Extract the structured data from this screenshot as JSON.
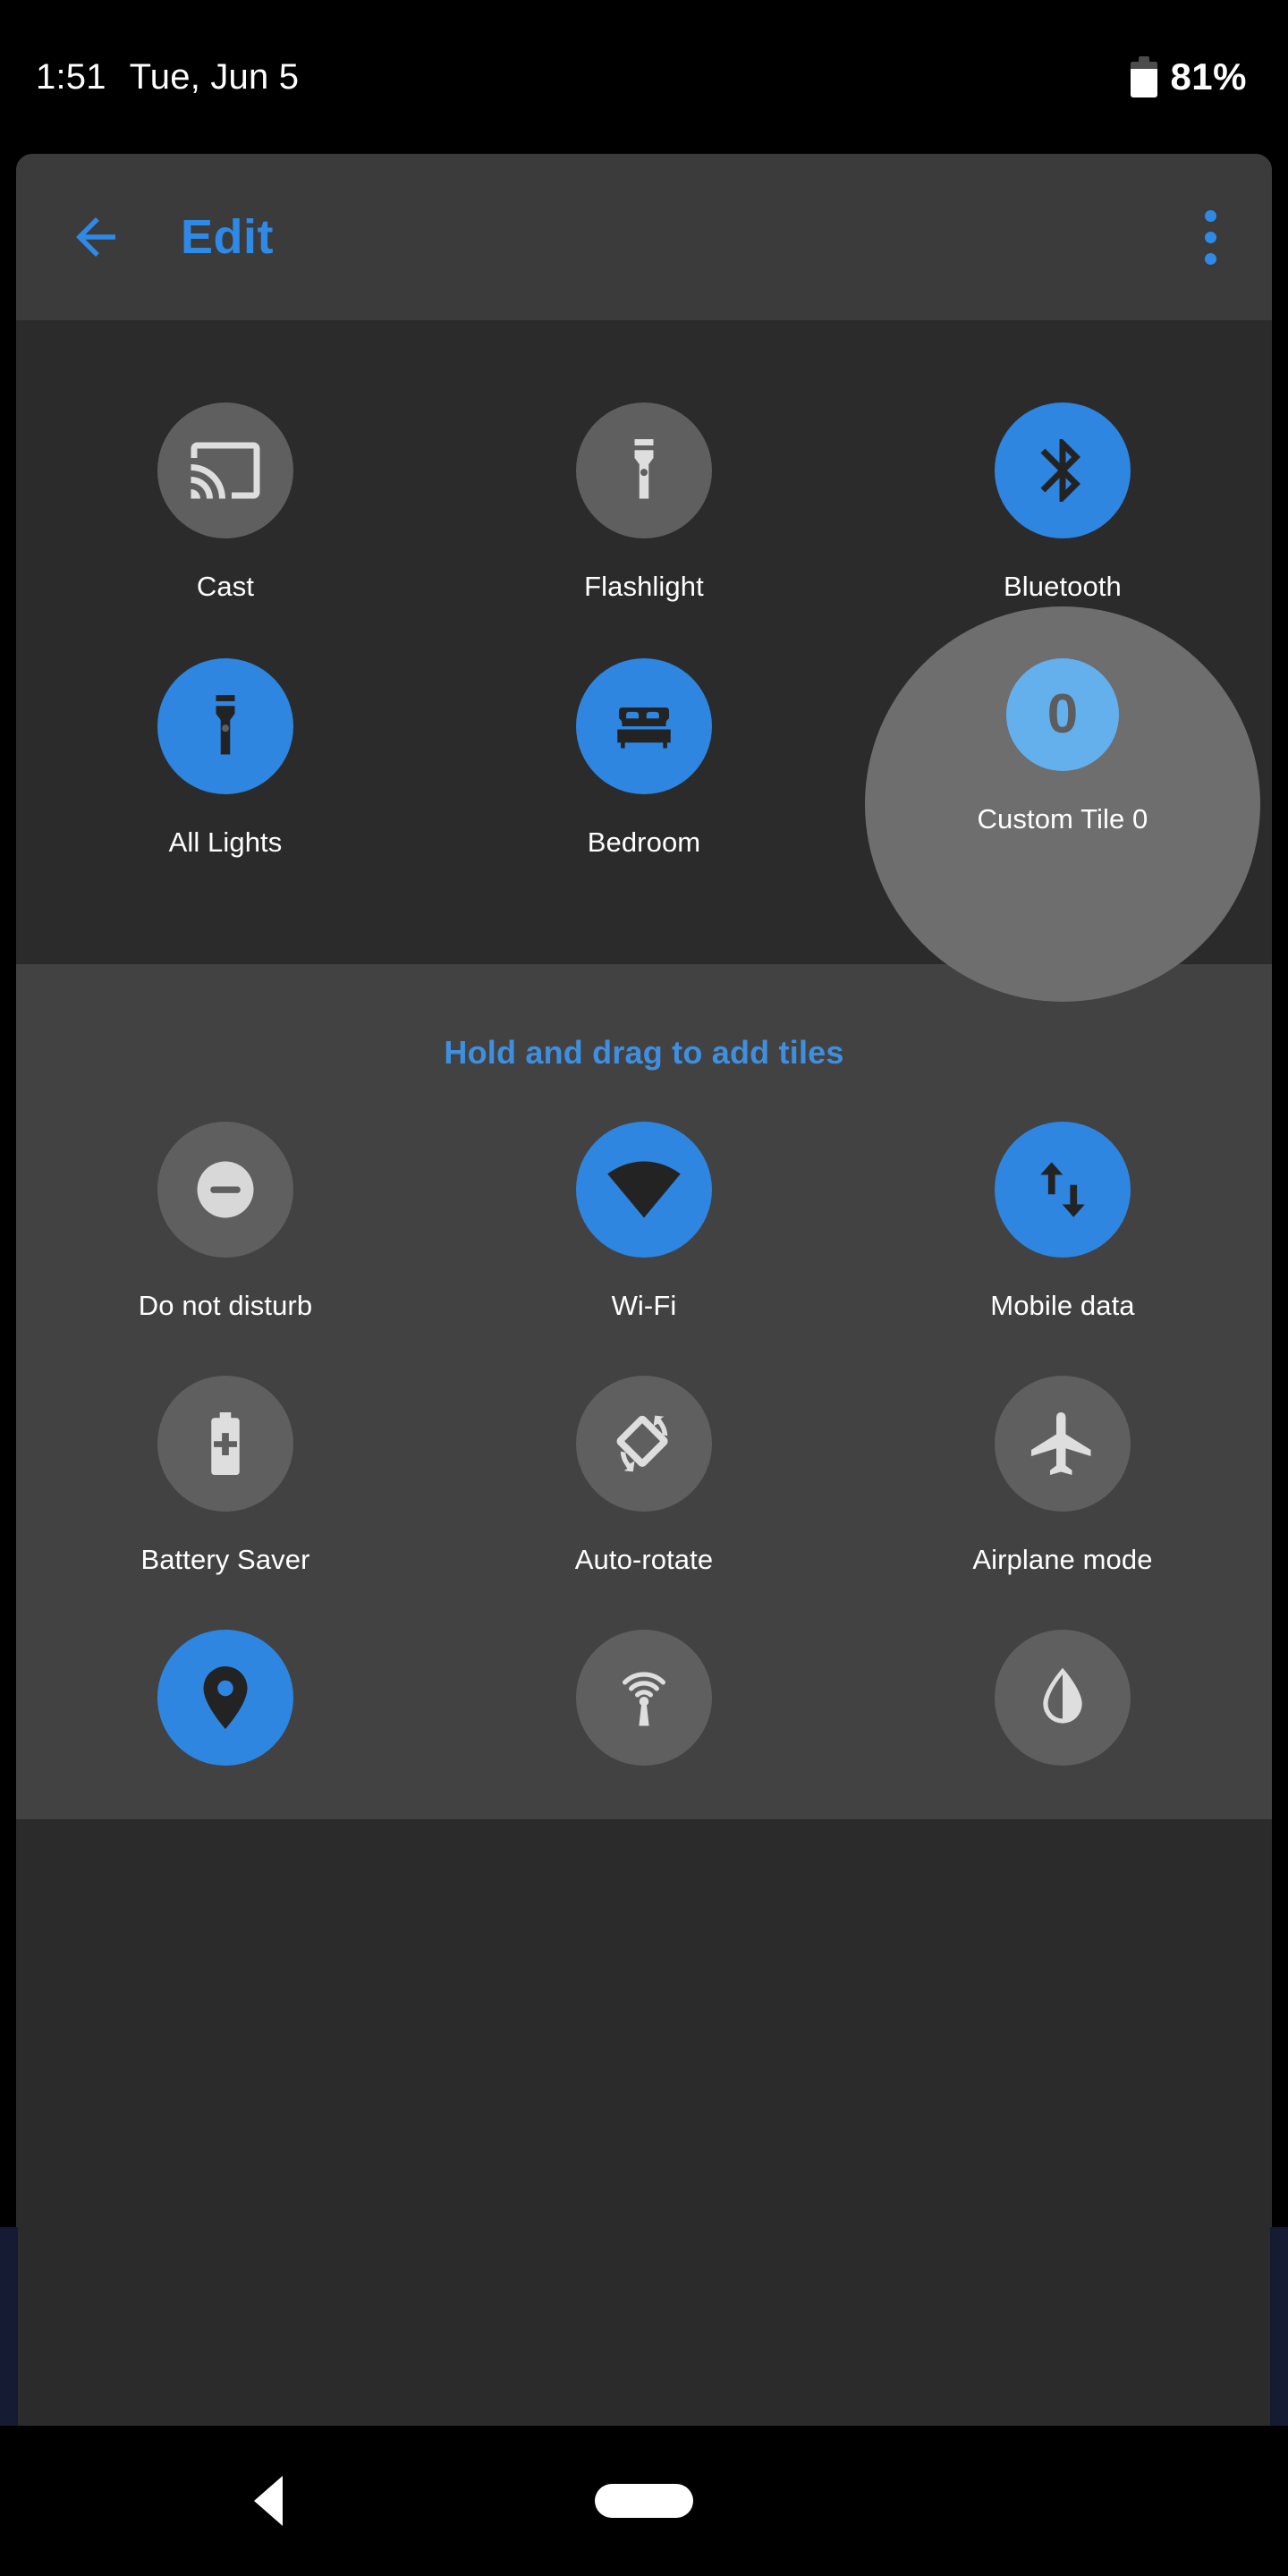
{
  "status_bar": {
    "time": "1:51",
    "date": "Tue, Jun 5",
    "battery_percent": "81%",
    "battery_icon": "battery-icon"
  },
  "toolbar": {
    "title": "Edit",
    "back_icon": "back-arrow-icon",
    "overflow_icon": "overflow-menu-icon",
    "accent_color": "#2e8ae6"
  },
  "current_tiles": {
    "rows": [
      [
        {
          "label": "Cast",
          "icon": "cast-icon",
          "state": "off"
        },
        {
          "label": "Flashlight",
          "icon": "flashlight-icon",
          "state": "off"
        },
        {
          "label": "Bluetooth",
          "icon": "bluetooth-icon",
          "state": "on"
        }
      ],
      [
        {
          "label": "All Lights",
          "icon": "flashlight-icon",
          "state": "on"
        },
        {
          "label": "Bedroom",
          "icon": "bed-icon",
          "state": "on"
        },
        {
          "label": "Custom Tile 0",
          "icon": "zero-icon",
          "icon_text": "0",
          "state": "selected"
        }
      ]
    ]
  },
  "available_section": {
    "hint": "Hold and drag to add tiles",
    "hint_color": "#3f8fe0",
    "rows": [
      [
        {
          "label": "Do not disturb",
          "icon": "do-not-disturb-icon",
          "state": "off"
        },
        {
          "label": "Wi-Fi",
          "icon": "wifi-icon",
          "state": "on"
        },
        {
          "label": "Mobile data",
          "icon": "mobile-data-icon",
          "state": "on"
        }
      ],
      [
        {
          "label": "Battery Saver",
          "icon": "battery-saver-icon",
          "state": "off"
        },
        {
          "label": "Auto-rotate",
          "icon": "auto-rotate-icon",
          "state": "off"
        },
        {
          "label": "Airplane mode",
          "icon": "airplane-icon",
          "state": "off"
        }
      ],
      [
        {
          "label": "",
          "icon": "location-icon",
          "state": "on"
        },
        {
          "label": "",
          "icon": "hotspot-icon",
          "state": "off"
        },
        {
          "label": "",
          "icon": "night-light-icon",
          "state": "off"
        }
      ]
    ]
  },
  "nav_bar": {
    "back_icon": "nav-back-icon",
    "home_icon": "nav-home-pill-icon"
  },
  "colors": {
    "tile_on": "#2e86e0",
    "tile_off": "#5f5f5f",
    "selection_ring": "#6e6e6e",
    "selected_tile": "#64b0ed",
    "card_top_bg": "#2b2b2b",
    "card_bottom_bg": "#424242",
    "toolbar_bg": "#3b3b3b",
    "edge_strip": "#141b33"
  }
}
